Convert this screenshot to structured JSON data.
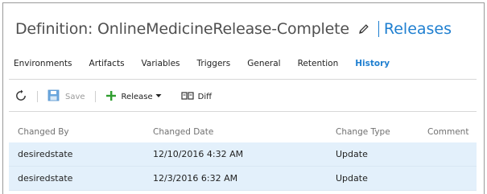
{
  "header": {
    "title": "Definition: OnlineMedicineRelease-Complete",
    "releases_link": "Releases"
  },
  "tabs": [
    {
      "label": "Environments",
      "active": false
    },
    {
      "label": "Artifacts",
      "active": false
    },
    {
      "label": "Variables",
      "active": false
    },
    {
      "label": "Triggers",
      "active": false
    },
    {
      "label": "General",
      "active": false
    },
    {
      "label": "Retention",
      "active": false
    },
    {
      "label": "History",
      "active": true
    }
  ],
  "toolbar": {
    "save_label": "Save",
    "release_label": "Release",
    "diff_label": "Diff"
  },
  "grid": {
    "columns": [
      "Changed By",
      "Changed Date",
      "Change Type",
      "Comment"
    ],
    "rows": [
      [
        "desiredstate",
        "12/10/2016 4:32 AM",
        "Update",
        ""
      ],
      [
        "desiredstate",
        "12/3/2016 6:32 AM",
        "Update",
        ""
      ]
    ]
  },
  "colors": {
    "accent": "#1f7fd0",
    "selected_row": "#e3f0fb",
    "add_icon": "#2f9e2f"
  },
  "icons": [
    "pencil-icon",
    "refresh-icon",
    "save-icon",
    "plus-icon",
    "chevron-down-icon",
    "diff-icon"
  ]
}
